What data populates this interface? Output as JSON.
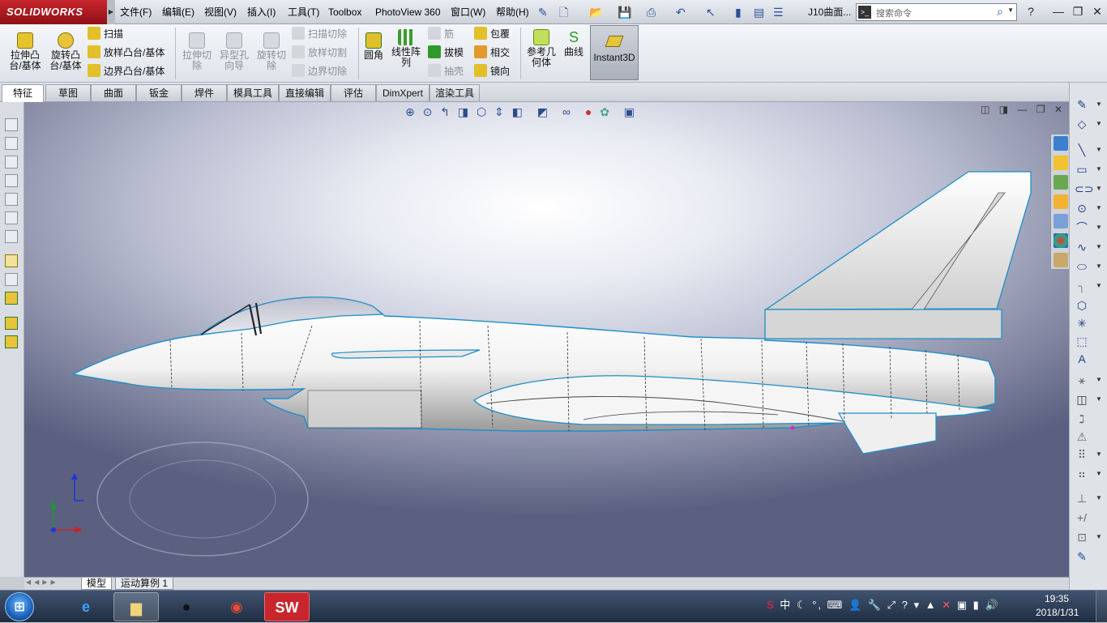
{
  "app": {
    "name": "SOLIDWORKS",
    "brand_color": "#c0272d",
    "document_title": "J10曲面..."
  },
  "menu": [
    {
      "label": "文件(F)"
    },
    {
      "label": "编辑(E)"
    },
    {
      "label": "视图(V)"
    },
    {
      "label": "插入(I)"
    },
    {
      "label": "工具(T)"
    },
    {
      "label": "Toolbox"
    },
    {
      "label": "PhotoView 360"
    },
    {
      "label": "窗口(W)"
    },
    {
      "label": "帮助(H)"
    }
  ],
  "search": {
    "placeholder": "搜索命令"
  },
  "ribbon": {
    "extrude_boss": "拉伸凸\n台/基体",
    "revolve_boss": "旋转凸\n台/基体",
    "sweep": "扫描",
    "loft_boss": "放样凸台/基体",
    "boundary_boss": "边界凸台/基体",
    "extrude_cut": "拉伸切\n除",
    "hole_wizard": "异型孔\n向导",
    "revolve_cut": "旋转切\n除",
    "sweep_cut": "扫描切除",
    "loft_cut": "放样切割",
    "boundary_cut": "边界切除",
    "fillet": "圆角",
    "linear_pattern": "线性阵\n列",
    "rib": "筋",
    "draft": "拔模",
    "shell": "抽壳",
    "wrap": "包覆",
    "intersect": "相交",
    "mirror": "镜向",
    "reference_geometry": "参考几\n何体",
    "curves": "曲线",
    "instant3d": "Instant3D"
  },
  "tabs": [
    {
      "label": "特征",
      "active": true
    },
    {
      "label": "草图"
    },
    {
      "label": "曲面"
    },
    {
      "label": "钣金"
    },
    {
      "label": "焊件"
    },
    {
      "label": "模具工具"
    },
    {
      "label": "直接编辑"
    },
    {
      "label": "评估"
    },
    {
      "label": "DimXpert"
    },
    {
      "label": "渲染工具"
    }
  ],
  "triad": {
    "x": "X",
    "y": "Y"
  },
  "bottom_tabs": [
    {
      "label": "模型",
      "active": true
    },
    {
      "label": "运动算例 1"
    }
  ],
  "taskbar": {
    "ime": "中",
    "time": "19:35",
    "date": "2018/1/31",
    "apps": [
      "ie-icon",
      "explorer-icon",
      "qq-icon",
      "chrome-icon",
      "solidworks-icon"
    ]
  },
  "colors": {
    "model_edge": "#1e8fc7",
    "viewport_top": "#ffffff",
    "viewport_bottom": "#5b6080"
  }
}
